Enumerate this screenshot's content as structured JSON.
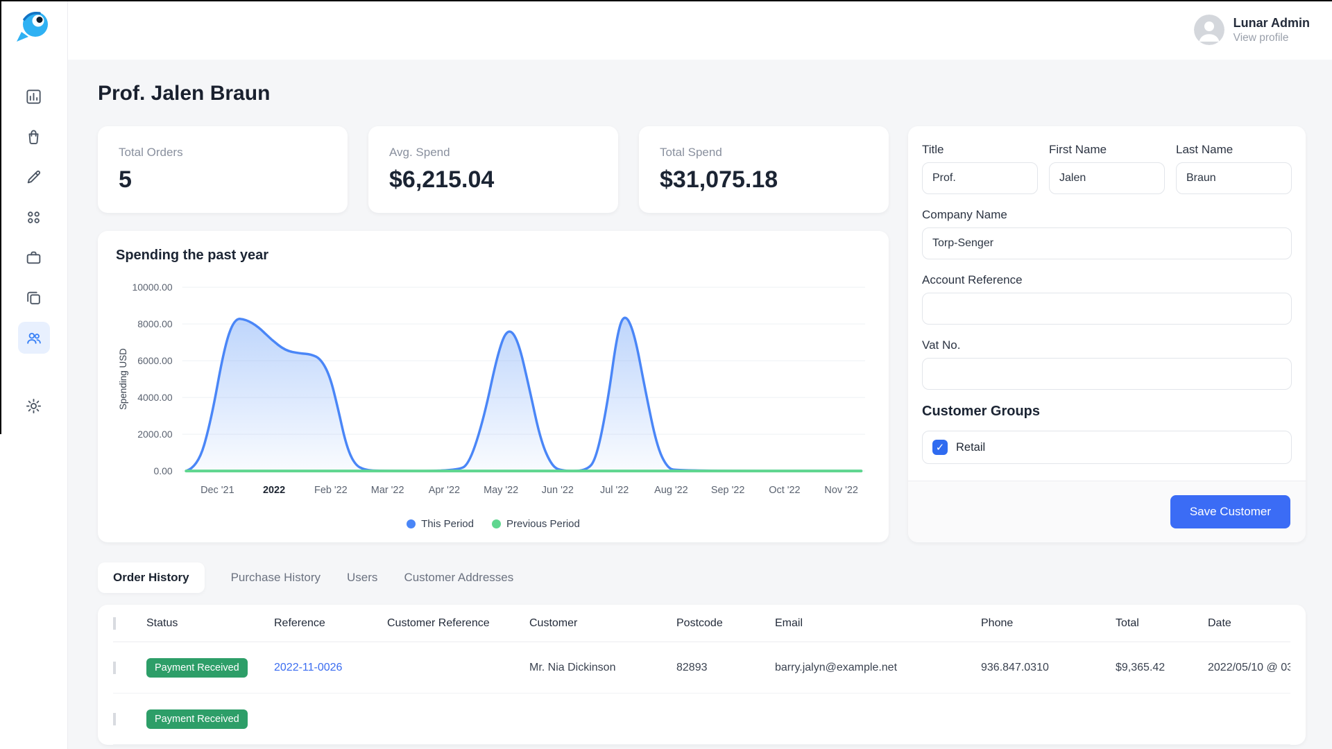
{
  "topbar": {
    "user_name": "Lunar Admin",
    "user_action": "View profile"
  },
  "sidebar": {
    "icons": [
      "bar-chart",
      "shopping-bag",
      "pencil",
      "apps-grid",
      "briefcase",
      "cards",
      "users",
      "gear"
    ],
    "active_icon": "users"
  },
  "page": {
    "title": "Prof. Jalen Braun"
  },
  "stats": [
    {
      "label": "Total Orders",
      "value": "5"
    },
    {
      "label": "Avg. Spend",
      "value": "$6,215.04"
    },
    {
      "label": "Total Spend",
      "value": "$31,075.18"
    }
  ],
  "chart_data": {
    "type": "area",
    "title": "Spending the past year",
    "ylabel": "Spending USD",
    "ylim": [
      0,
      10000
    ],
    "y_ticks": [
      0,
      2000,
      4000,
      6000,
      8000,
      10000
    ],
    "y_tick_labels": [
      "0.00",
      "2000.00",
      "4000.00",
      "6000.00",
      "8000.00",
      "10000.00"
    ],
    "x_labels": [
      "Dec '21",
      "2022",
      "Feb '22",
      "Mar '22",
      "Apr '22",
      "May '22",
      "Jun '22",
      "Jul '22",
      "Aug '22",
      "Sep '22",
      "Oct '22",
      "Nov '22"
    ],
    "x_bold_index": 1,
    "x_range": [
      -0.62,
      11.42
    ],
    "grid": true,
    "legend_position": "bottom",
    "series": [
      {
        "name": "This Period",
        "color": "#4a86f7",
        "fill": true,
        "points": [
          [
            -0.55,
            0
          ],
          [
            -0.35,
            200
          ],
          [
            -0.12,
            2600
          ],
          [
            0.12,
            6700
          ],
          [
            0.3,
            8300
          ],
          [
            0.5,
            8250
          ],
          [
            0.72,
            7850
          ],
          [
            0.95,
            7150
          ],
          [
            1.2,
            6550
          ],
          [
            1.45,
            6400
          ],
          [
            1.65,
            6350
          ],
          [
            1.82,
            6100
          ],
          [
            1.98,
            5200
          ],
          [
            2.12,
            3500
          ],
          [
            2.27,
            1400
          ],
          [
            2.42,
            350
          ],
          [
            2.6,
            50
          ],
          [
            2.85,
            0
          ],
          [
            4.25,
            0
          ],
          [
            4.45,
            450
          ],
          [
            4.7,
            2900
          ],
          [
            4.95,
            6500
          ],
          [
            5.12,
            7800
          ],
          [
            5.3,
            7150
          ],
          [
            5.5,
            4500
          ],
          [
            5.7,
            1650
          ],
          [
            5.9,
            250
          ],
          [
            6.08,
            0
          ],
          [
            6.5,
            0
          ],
          [
            6.68,
            650
          ],
          [
            6.88,
            3700
          ],
          [
            7.05,
            7500
          ],
          [
            7.18,
            8600
          ],
          [
            7.35,
            7550
          ],
          [
            7.55,
            4300
          ],
          [
            7.75,
            1350
          ],
          [
            7.93,
            180
          ],
          [
            8.1,
            0
          ],
          [
            11.35,
            0
          ]
        ]
      },
      {
        "name": "Previous Period",
        "color": "#5fd68f",
        "fill": false,
        "points": [
          [
            -0.55,
            0
          ],
          [
            11.35,
            0
          ]
        ]
      }
    ]
  },
  "form": {
    "fields": {
      "title": {
        "label": "Title",
        "value": "Prof."
      },
      "first_name": {
        "label": "First Name",
        "value": "Jalen"
      },
      "last_name": {
        "label": "Last Name",
        "value": "Braun"
      },
      "company_name": {
        "label": "Company Name",
        "value": "Torp-Senger"
      },
      "account_reference": {
        "label": "Account Reference",
        "value": ""
      },
      "vat_no": {
        "label": "Vat No.",
        "value": ""
      }
    },
    "customer_groups": {
      "heading": "Customer Groups",
      "options": [
        {
          "label": "Retail",
          "checked": true
        }
      ]
    },
    "save_button": "Save Customer"
  },
  "tabs": [
    {
      "label": "Order History",
      "active": true
    },
    {
      "label": "Purchase History",
      "active": false
    },
    {
      "label": "Users",
      "active": false
    },
    {
      "label": "Customer Addresses",
      "active": false
    }
  ],
  "table": {
    "columns": [
      "Status",
      "Reference",
      "Customer Reference",
      "Customer",
      "Postcode",
      "Email",
      "Phone",
      "Total",
      "Date"
    ],
    "rows": [
      {
        "status": "Payment Received",
        "reference": "2022-11-0026",
        "customer_reference": "",
        "customer": "Mr. Nia Dickinson",
        "postcode": "82893",
        "email": "barry.jalyn@example.net",
        "phone": "936.847.0310",
        "total": "$9,365.42",
        "date": "2022/05/10 @ 03"
      },
      {
        "status": "Payment Received",
        "reference": "",
        "customer_reference": "",
        "customer": "",
        "postcode": "",
        "email": "",
        "phone": "",
        "total": "",
        "date": ""
      }
    ]
  },
  "colors": {
    "accent_blue": "#3b6cf5",
    "badge_green": "#2d9e68",
    "link_blue": "#3a6cf0",
    "chart_blue": "#4a86f7",
    "chart_green": "#5fd68f",
    "active_nav_bg": "#e8f0fe"
  }
}
